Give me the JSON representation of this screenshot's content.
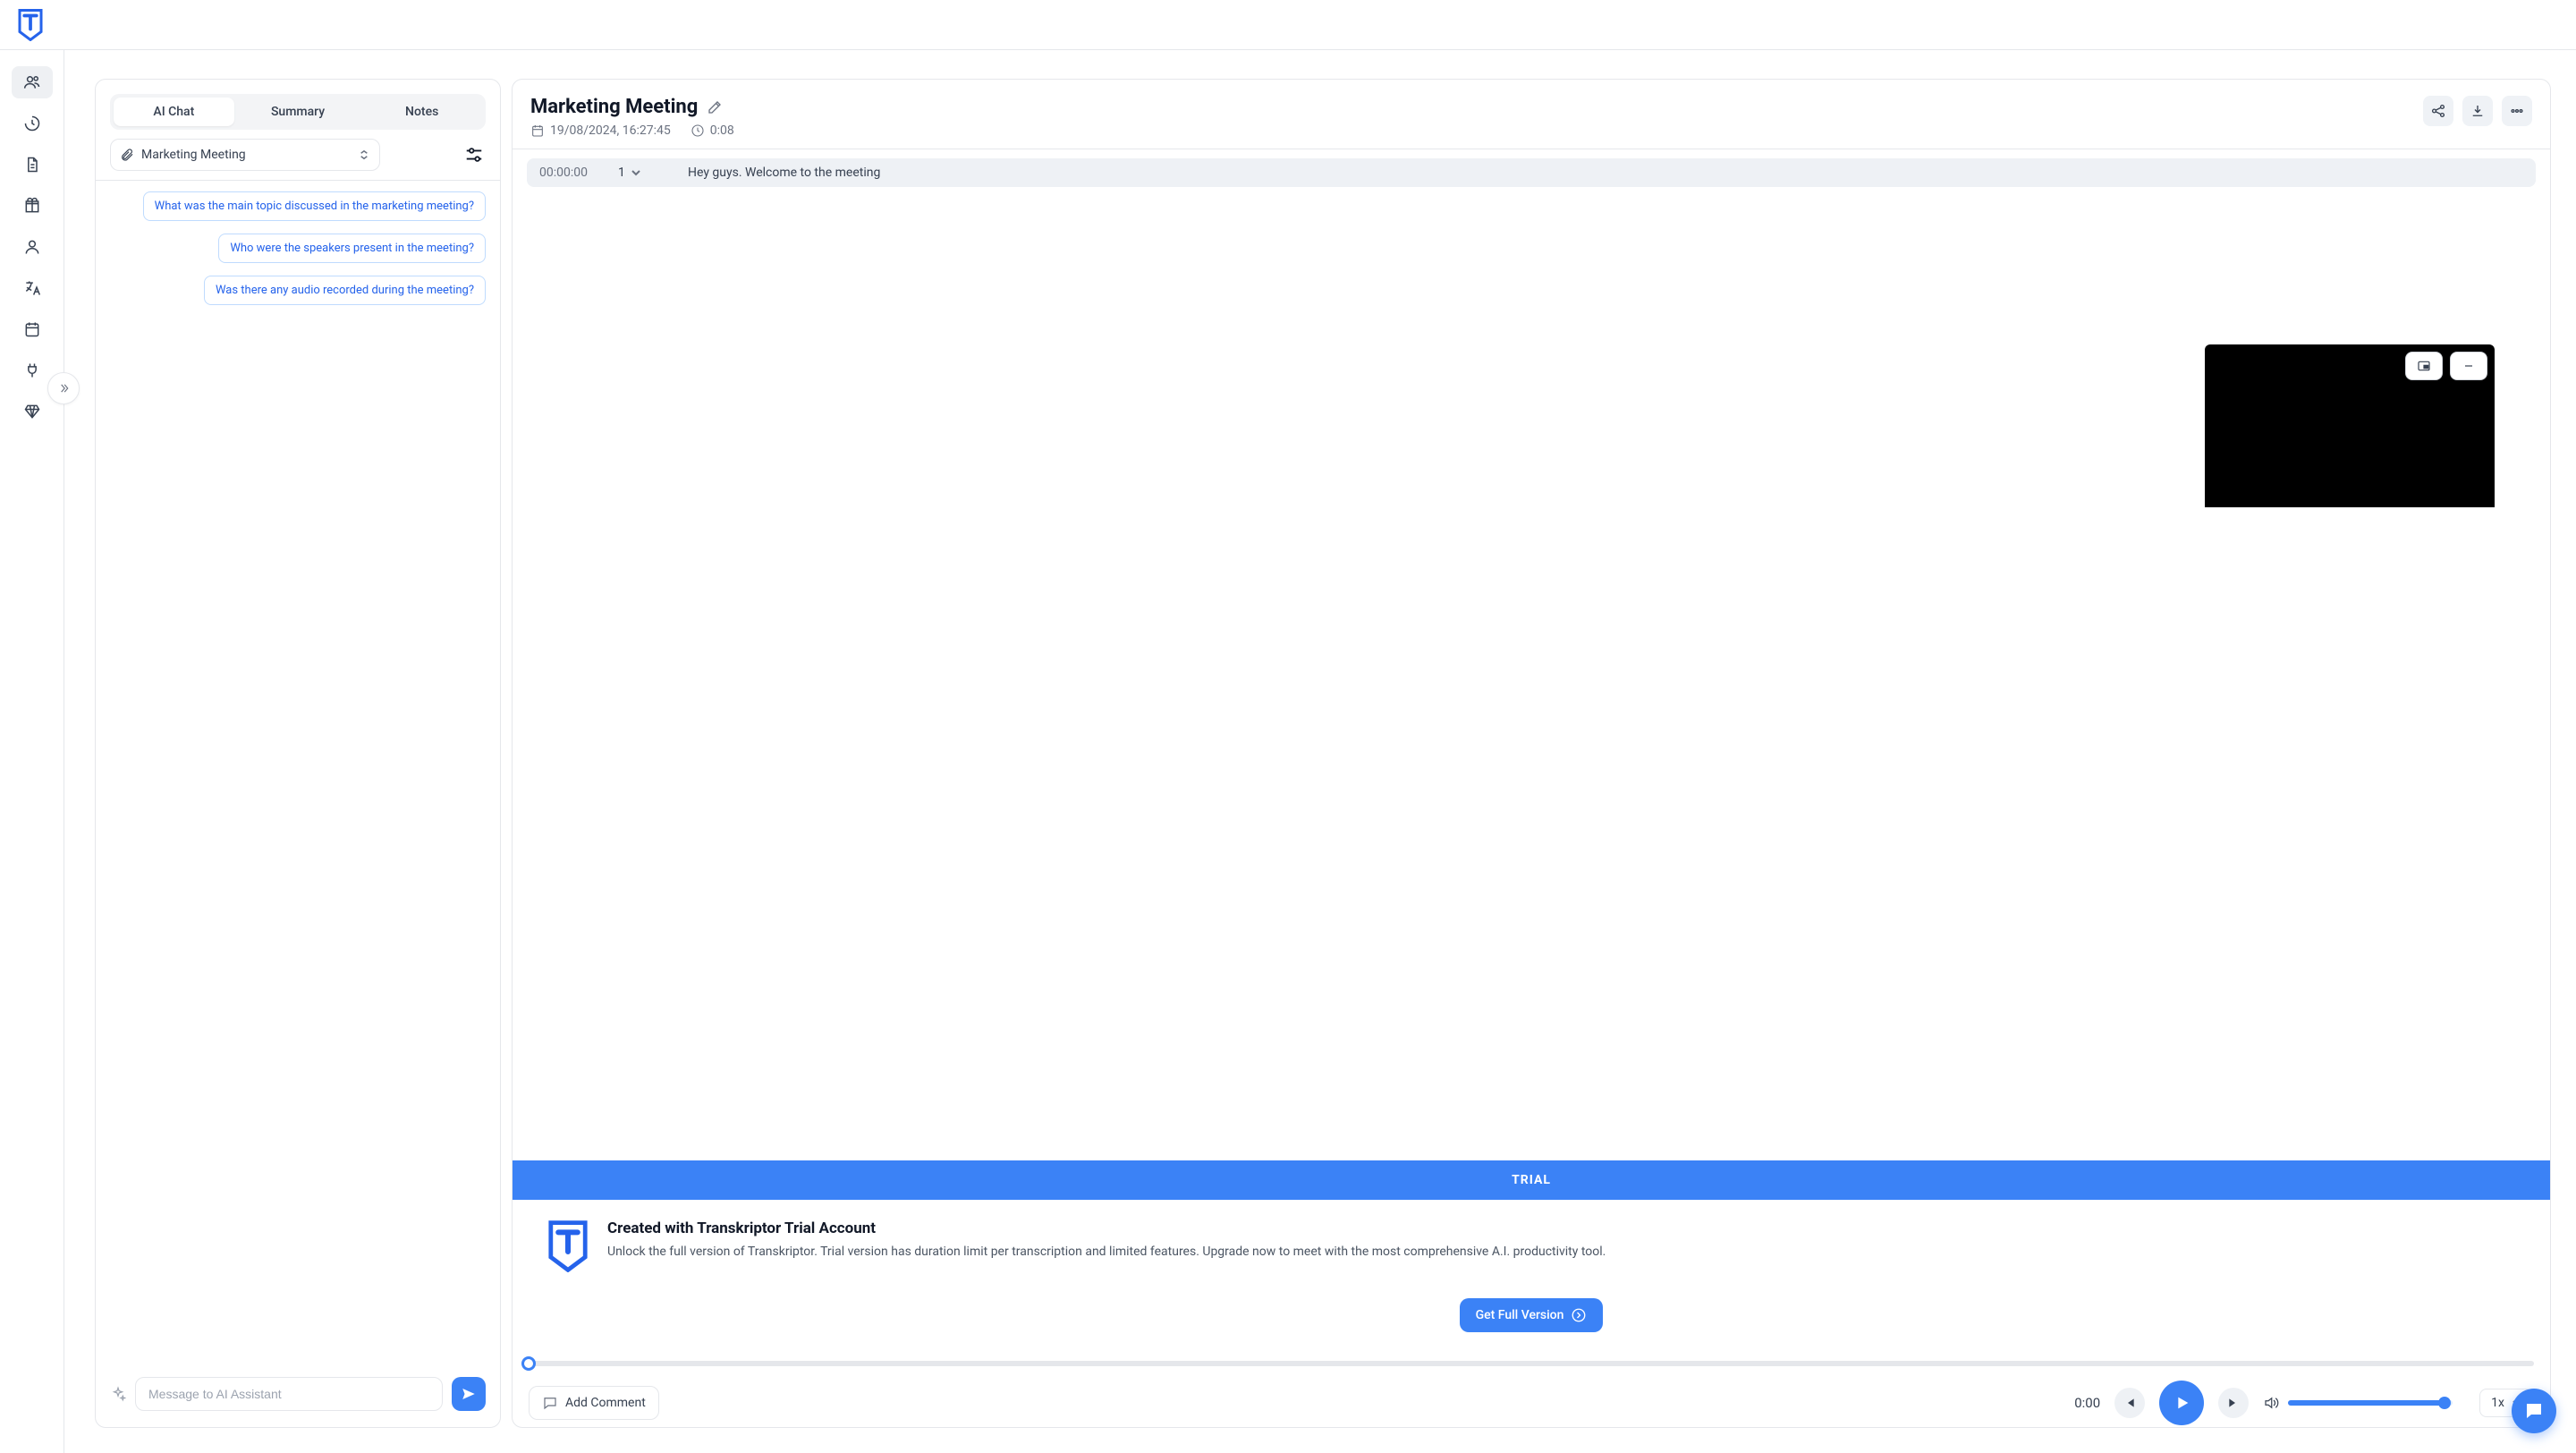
{
  "left": {
    "tabs": {
      "ai": "AI Chat",
      "summary": "Summary",
      "notes": "Notes"
    },
    "attachment": "Marketing Meeting",
    "suggestions": [
      "What was the main topic discussed in the marketing meeting?",
      "Who were the speakers present in the meeting?",
      "Was there any audio recorded during the meeting?"
    ],
    "input_placeholder": "Message to AI Assistant"
  },
  "meeting": {
    "title": "Marketing Meeting",
    "date": "19/08/2024, 16:27:45",
    "duration": "0:08",
    "transcript": [
      {
        "time": "00:00:00",
        "speaker": "1",
        "text": "Hey guys. Welcome to the meeting"
      }
    ]
  },
  "trial": {
    "bar": "TRIAL",
    "heading": "Created with Transkriptor Trial Account",
    "body": "Unlock the full version of Transkriptor. Trial version has duration limit per transcription and limited features. Upgrade now to meet with the most comprehensive A.I. productivity tool.",
    "cta": "Get Full Version"
  },
  "player": {
    "time": "0:00",
    "add_comment": "Add Comment",
    "speed": "1x"
  }
}
